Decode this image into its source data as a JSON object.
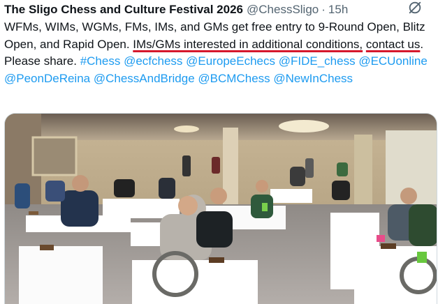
{
  "tweet": {
    "author_name": "The Sligo Chess and Culture Festival 2026",
    "author_handle": "@ChessSligo",
    "separator": "·",
    "time": "15h",
    "text_part1": "WFMs, WIMs, WGMs, FMs, IMs, and GMs get free entry to 9-Round Open, Blitz Open, and Rapid Open. ",
    "text_highlight1": "IMs/GMs interested in additional conditions,",
    "text_space": " ",
    "text_highlight2": "contact us",
    "text_part2": ". Please share. ",
    "hashtags": [
      "#Chess",
      "@ecfchess",
      "@EuropeEchecs",
      "@FIDE_chess",
      "@ECUonline",
      "@PeonDeReina",
      "@ChessAndBridge",
      "@BCMChess",
      "@NewInChess"
    ],
    "media": {
      "image_icon": "chess-tournament-photo"
    }
  },
  "colors": {
    "link": "#1d9bf0",
    "underline": "#d6182c",
    "muted": "#536471"
  },
  "icons": {
    "grok": "grok-icon"
  }
}
